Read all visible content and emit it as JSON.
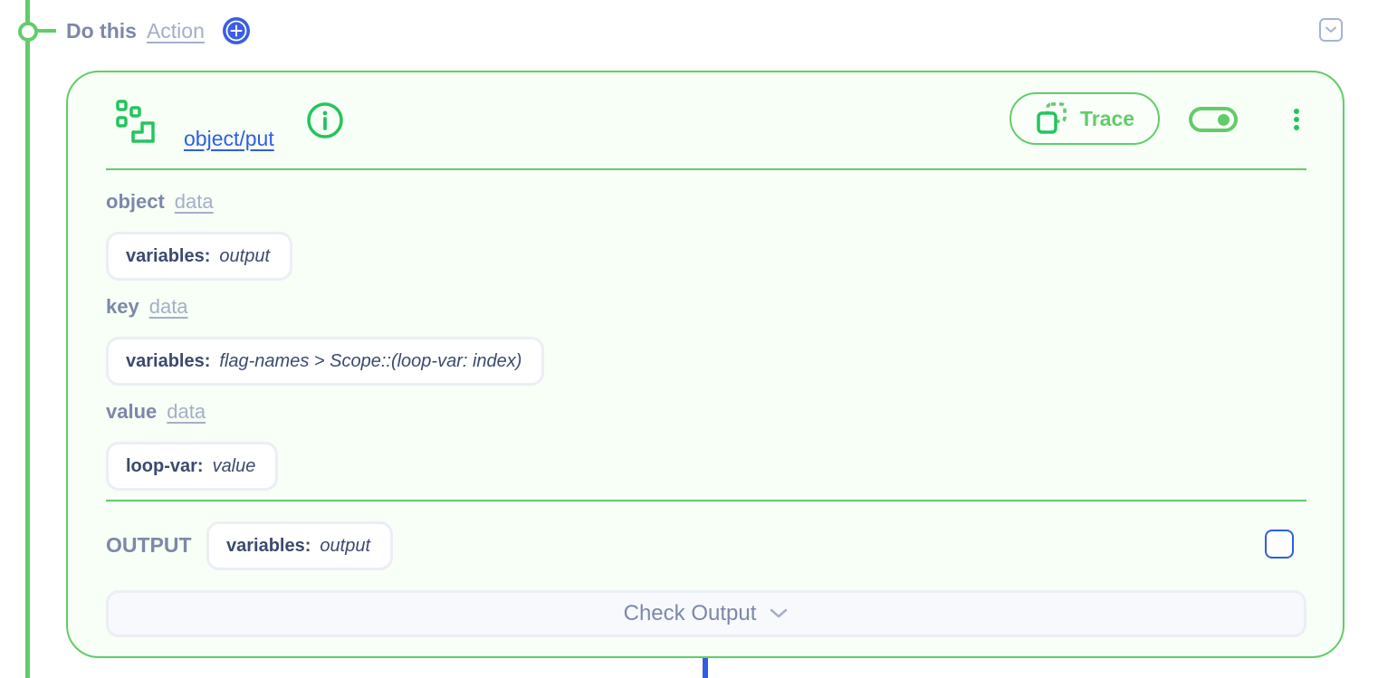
{
  "header": {
    "title": "Do this",
    "type_link": "Action",
    "add_icon": "plus-circle-icon",
    "collapse_icon": "chevron-down-square-icon"
  },
  "step": {
    "icon": "steps-icon",
    "name": "object/put",
    "info_icon": "info-circle-icon",
    "trace_label": "Trace",
    "trace_icon": "copy-dashed-icon",
    "enabled": true,
    "menu_icon": "kebab-menu-icon"
  },
  "params": [
    {
      "name": "object",
      "type": "data",
      "value_key": "variables:",
      "value": "output"
    },
    {
      "name": "key",
      "type": "data",
      "value_key": "variables:",
      "value": "flag-names > Scope::(loop-var: index)"
    },
    {
      "name": "value",
      "type": "data",
      "value_key": "loop-var:",
      "value": "value"
    }
  ],
  "output": {
    "label": "OUTPUT",
    "value_key": "variables:",
    "value": "output",
    "checked": false
  },
  "check_output": {
    "label": "Check Output",
    "icon": "chevron-down-icon"
  },
  "colors": {
    "accent_green": "#62cc6a",
    "link_blue": "#2f5de5",
    "muted_label": "#7c88a9",
    "card_bg": "#f8fff6"
  }
}
